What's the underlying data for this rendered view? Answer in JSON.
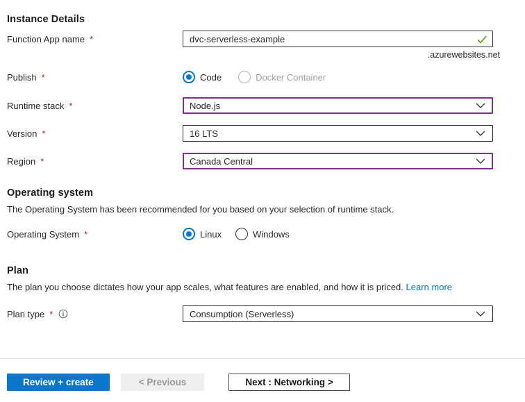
{
  "required_marker": "*",
  "colors": {
    "primary_blue": "#0078d4",
    "purple_border": "#7e2f8e",
    "required_red": "#a4262c",
    "check_green": "#57a300",
    "link_blue": "#0078d4"
  },
  "instance_details": {
    "heading": "Instance Details",
    "function_app_name": {
      "label": "Function App name",
      "value": "dvc-serverless-example",
      "suffix": ".azurewebsites.net",
      "valid": true
    },
    "publish": {
      "label": "Publish",
      "options": [
        {
          "label": "Code",
          "selected": true,
          "disabled": false
        },
        {
          "label": "Docker Container",
          "selected": false,
          "disabled": true
        }
      ]
    },
    "runtime_stack": {
      "label": "Runtime stack",
      "value": "Node.js"
    },
    "version": {
      "label": "Version",
      "value": "16 LTS"
    },
    "region": {
      "label": "Region",
      "value": "Canada Central"
    }
  },
  "operating_system": {
    "heading": "Operating system",
    "description": "The Operating System has been recommended for you based on your selection of runtime stack.",
    "field_label": "Operating System",
    "options": [
      {
        "label": "Linux",
        "selected": true
      },
      {
        "label": "Windows",
        "selected": false
      }
    ]
  },
  "plan": {
    "heading": "Plan",
    "description": "The plan you choose dictates how your app scales, what features are enabled, and how it is priced.",
    "learn_more_label": "Learn more",
    "plan_type": {
      "label": "Plan type",
      "value": "Consumption (Serverless)"
    }
  },
  "footer": {
    "review_create_label": "Review + create",
    "previous_label": "< Previous",
    "next_label": "Next : Networking >"
  }
}
